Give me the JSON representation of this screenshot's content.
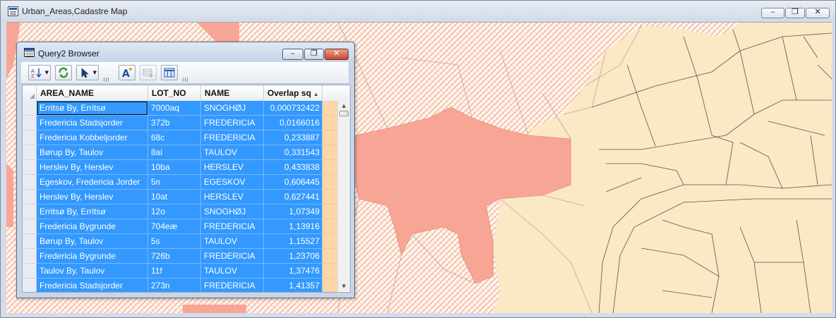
{
  "window": {
    "title": "Urban_Areas,Cadastre Map"
  },
  "colors": {
    "selection": "#3399ff",
    "map_background": "#fbe8c4",
    "urban_hatch": "#f4a090",
    "urban_solid": "#f7a595"
  },
  "dialog": {
    "title": "Query2 Browser",
    "toolbar": [
      "sort-icon",
      "refresh-icon",
      "select-pointer-icon",
      "autolabel-icon",
      "add-row-icon",
      "table-columns-icon"
    ]
  },
  "table": {
    "columns": [
      "AREA_NAME",
      "LOT_NO",
      "NAME",
      "Overlap sq"
    ],
    "sort_indicator": "▲",
    "rows": [
      [
        "Erritsø By, Erritsø",
        "7000aq",
        "SNOGHØJ",
        "0,000732422"
      ],
      [
        "Fredericia Stadsjorder",
        "372b",
        "FREDERICIA",
        "0,0166016"
      ],
      [
        "Fredericia Kobbeljorder",
        "68c",
        "FREDERICIA",
        "0,233887"
      ],
      [
        "Børup By, Taulov",
        "8ai",
        "TAULOV",
        "0,331543"
      ],
      [
        "Herslev By, Herslev",
        "10ba",
        "HERSLEV",
        "0,433838"
      ],
      [
        "Egeskov, Fredericia Jorder",
        "5n",
        "EGESKOV",
        "0,606445"
      ],
      [
        "Herslev By, Herslev",
        "10at",
        "HERSLEV",
        "0,627441"
      ],
      [
        "Erritsø By, Erritsø",
        "12o",
        "SNOGHØJ",
        "1,07349"
      ],
      [
        "Fredericia Bygrunde",
        "704eæ",
        "FREDERICIA",
        "1,13916"
      ],
      [
        "Børup By, Taulov",
        "5s",
        "TAULOV",
        "1,15527"
      ],
      [
        "Fredericia Bygrunde",
        "726b",
        "FREDERICIA",
        "1,23706"
      ],
      [
        "Taulov By, Taulov",
        "11f",
        "TAULOV",
        "1,37476"
      ],
      [
        "Fredericia Stadsjorder",
        "273n",
        "FREDERICIA",
        "1,41357"
      ]
    ]
  }
}
